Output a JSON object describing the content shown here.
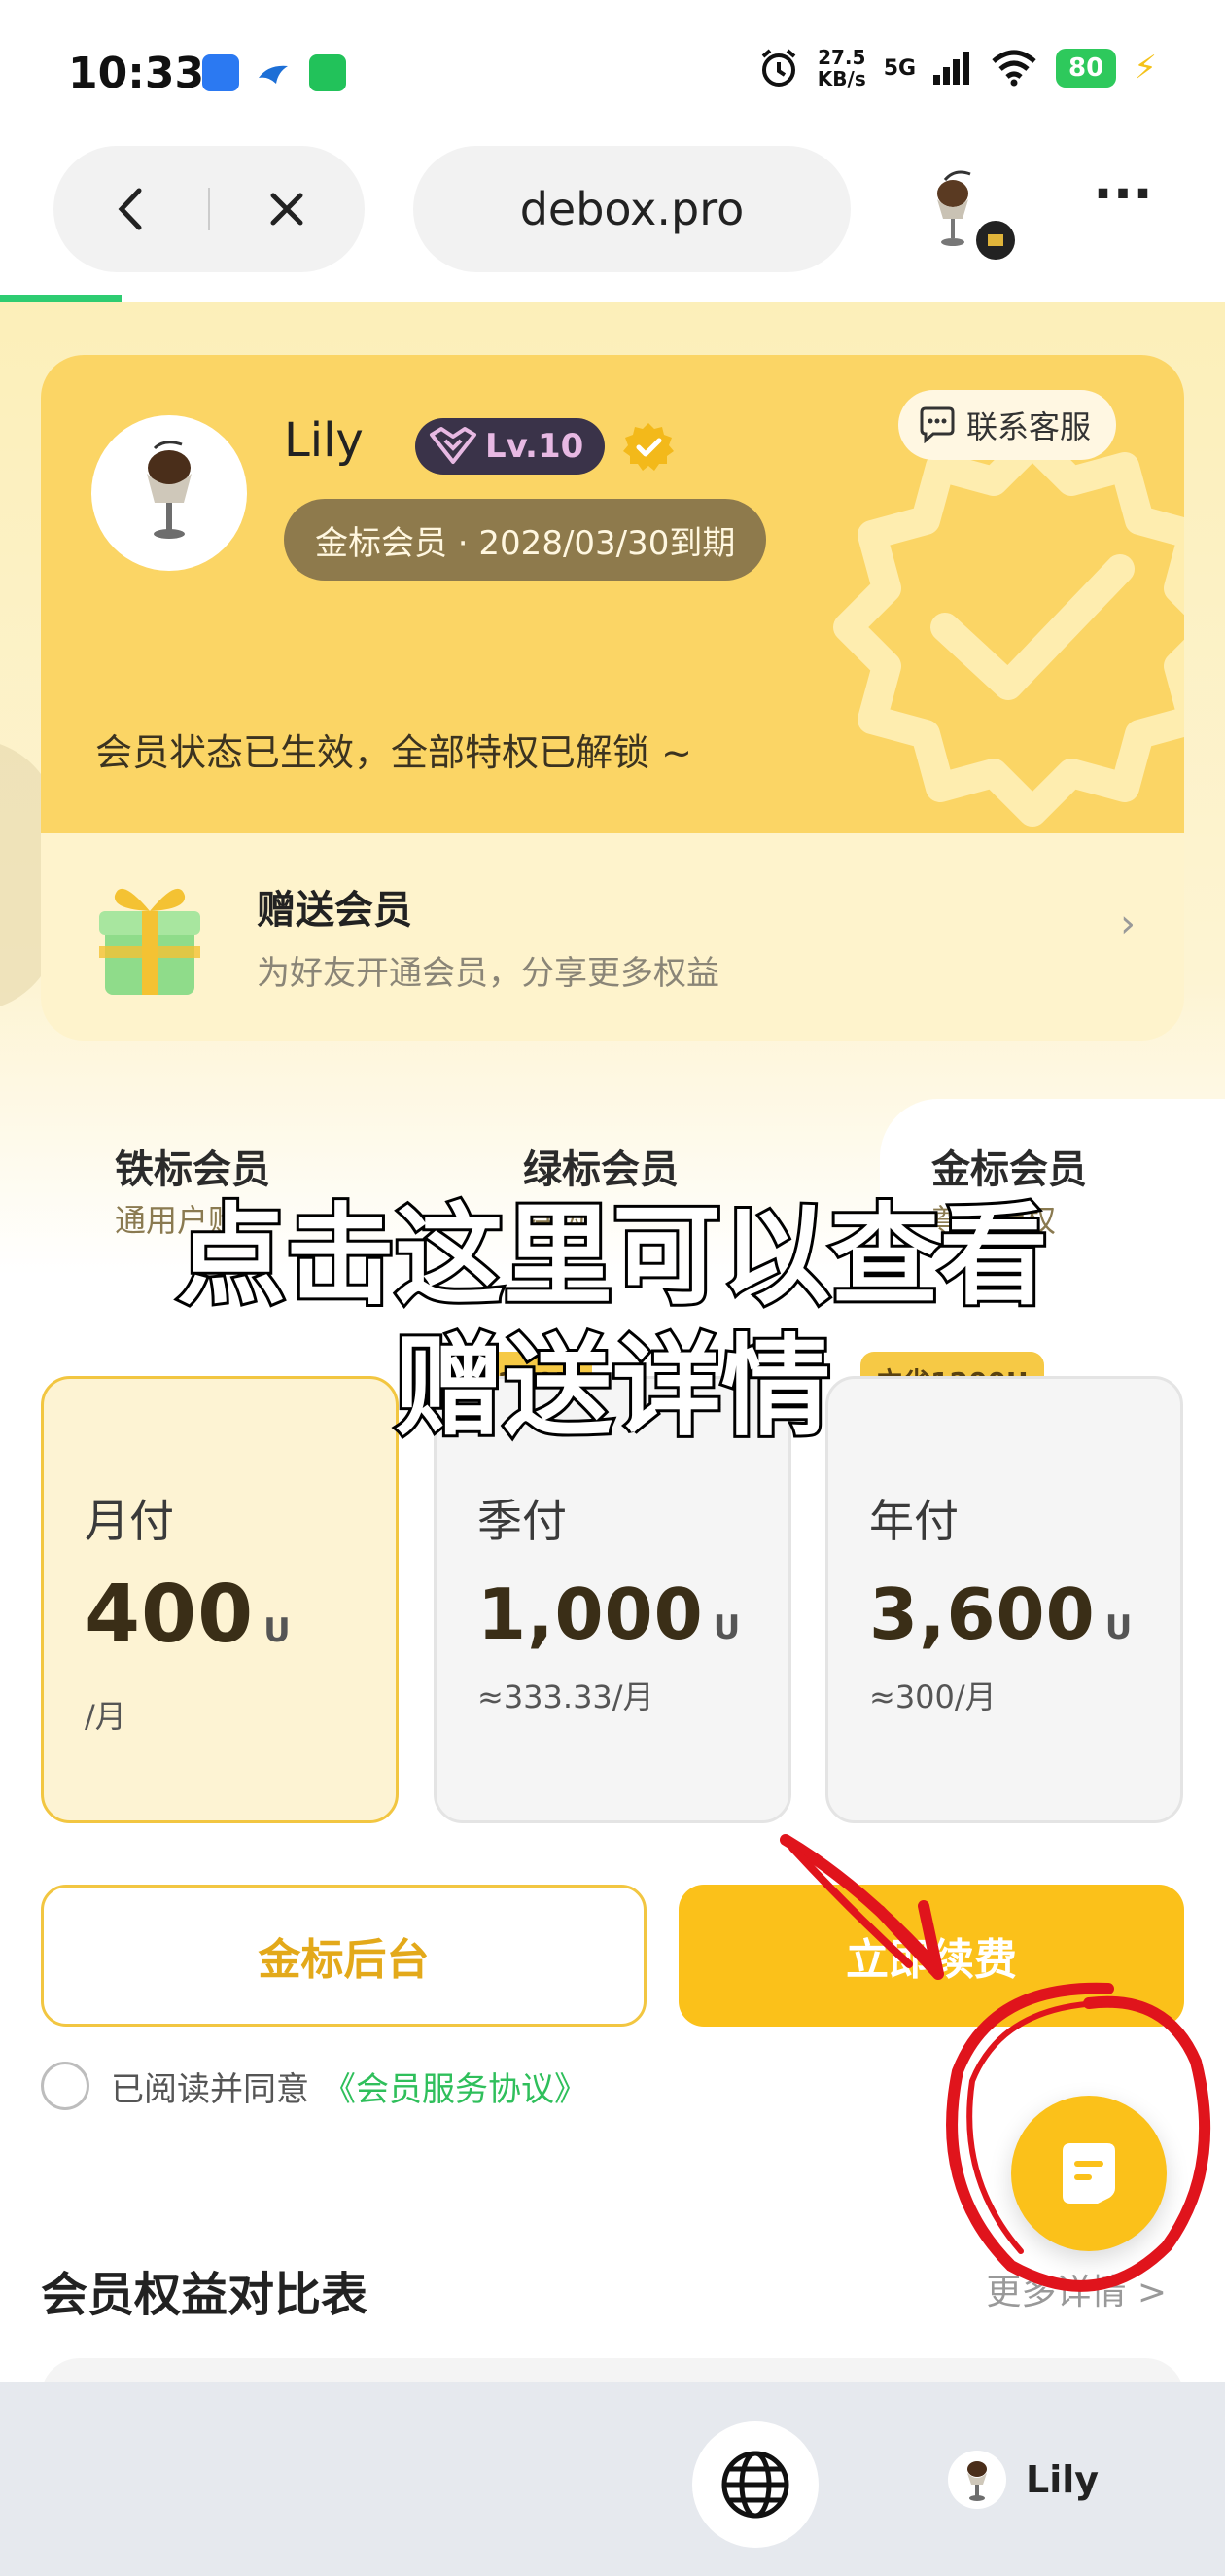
{
  "status_bar": {
    "time": "10:33",
    "net_speed_value": "27.5",
    "net_speed_unit": "KB/s",
    "signal": "5G",
    "battery": "80"
  },
  "browser": {
    "url": "debox.pro"
  },
  "profile": {
    "name": "Lily",
    "level": "Lv.10",
    "membership": "金标会员 · 2028/03/30到期",
    "contact_label": "联系客服",
    "status_message": "会员状态已生效，全部特权已解锁 ~"
  },
  "gift": {
    "title": "赠送会员",
    "subtitle": "为好友开通会员，分享更多权益"
  },
  "tabs": [
    {
      "label": "铁标会员",
      "sub": "通用户购"
    },
    {
      "label": "绿标会员",
      "sub": "特购"
    },
    {
      "label": "金标会员",
      "sub": "尊享特权"
    }
  ],
  "save_tags": [
    "立省200U",
    "立省1200U"
  ],
  "plans": [
    {
      "name": "月付",
      "price": "400",
      "unit": "U",
      "per": "/月"
    },
    {
      "name": "季付",
      "price": "1,000",
      "unit": "U",
      "per": "≈333.33/月"
    },
    {
      "name": "年付",
      "price": "3,600",
      "unit": "U",
      "per": "≈300/月"
    }
  ],
  "buttons": {
    "admin": "金标后台",
    "renew": "立即续费"
  },
  "agreement": {
    "prefix": "已阅读并同意",
    "link": "《会员服务协议》"
  },
  "compare": {
    "title": "会员权益对比表",
    "more": "更多详情 >"
  },
  "bottom_bar": {
    "user": "Lily"
  },
  "overlay": {
    "line1": "点击这里可以查看",
    "line2": "赠送详情"
  },
  "colors": {
    "gold": "#fbc11a",
    "card_top": "#fbd565",
    "link_green": "#2fbf5b",
    "annotation_red": "#e0141c"
  }
}
